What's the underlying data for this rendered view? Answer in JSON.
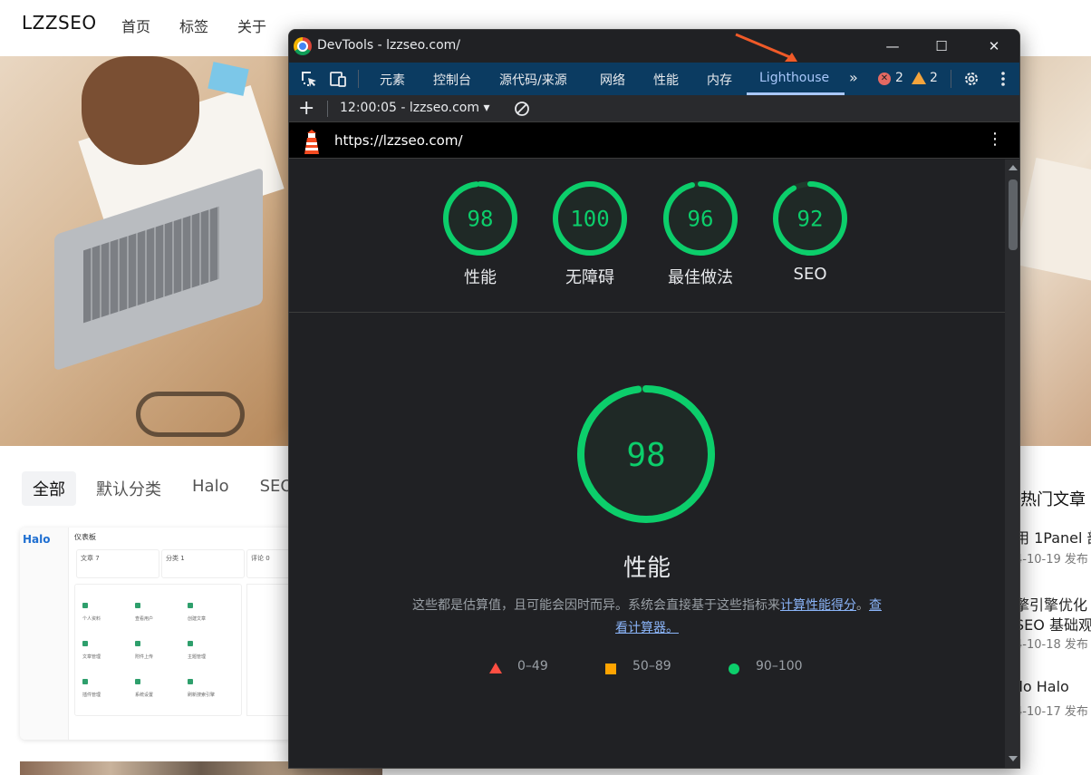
{
  "site": {
    "logo": "LZZSEO",
    "nav": [
      "首页",
      "标签",
      "关于"
    ],
    "categories": [
      "全部",
      "默认分类",
      "Halo",
      "SEO"
    ],
    "card": {
      "logo": "Halo",
      "title": "仪表板",
      "stats": [
        "文章 7",
        "分类 1",
        "评论 0"
      ],
      "tiles": [
        "个人资料",
        "查看用户",
        "创建文章",
        "文章管理",
        "附件上传",
        "主题管理",
        "插件管理",
        "系统设置",
        "刷新搜索引擎"
      ]
    },
    "hot": {
      "title": "热门文章",
      "items": [
        {
          "title": "用 1Panel 部",
          "date": "4-10-19 发布"
        },
        {
          "title": "擎引擎优化 (",
          "date": ""
        },
        {
          "title": "SEO 基础观",
          "date": "4-10-18 发布"
        },
        {
          "title": "llo Halo",
          "date": "4-10-17 发布"
        }
      ]
    }
  },
  "devtools": {
    "window_title": "DevTools - lzzseo.com/",
    "window_controls": {
      "minimize": "—",
      "maximize": "☐",
      "close": "✕"
    },
    "tabs": [
      {
        "label": "元素"
      },
      {
        "label": "控制台"
      },
      {
        "label": "源代码/来源"
      },
      {
        "label": "网络"
      },
      {
        "label": "性能"
      },
      {
        "label": "内存"
      },
      {
        "label": "Lighthouse"
      }
    ],
    "active_tab": "Lighthouse",
    "more_tabs": "»",
    "error_count": "2",
    "warning_count": "2",
    "report_selector": "12:00:05 - lzzseo.com ▾",
    "add": "+",
    "url": "https://lzzseo.com/",
    "menu": "⋮",
    "summary_scores": [
      {
        "label": "性能",
        "score": 98
      },
      {
        "label": "无障碍",
        "score": 100
      },
      {
        "label": "最佳做法",
        "score": 96
      },
      {
        "label": "SEO",
        "score": 92
      }
    ],
    "performance": {
      "score": 98,
      "title": "性能",
      "description_text": "这些都是估算值，且可能会因时而异。系统会直接基于这些指标来",
      "link1": "计算性能得分",
      "sep": "。",
      "link2": "查看计算器。"
    },
    "legend": [
      {
        "shape": "triangle",
        "range": "0–49",
        "color": "#ff4e42"
      },
      {
        "shape": "square",
        "range": "50–89",
        "color": "#ffa400"
      },
      {
        "shape": "circle",
        "range": "90–100",
        "color": "#0cce6b"
      }
    ],
    "colors": {
      "pass": "#0cce6b",
      "gauge_bg": "#1f3a2c",
      "toolbar": "#0b3b61",
      "annotation": "#f05a28"
    }
  }
}
